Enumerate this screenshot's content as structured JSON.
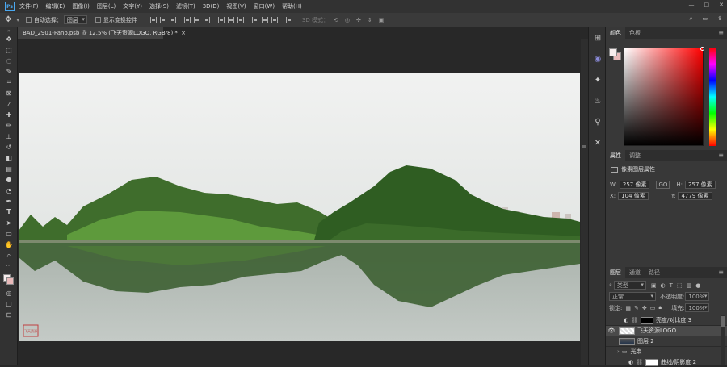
{
  "app": {
    "logo": "Ps"
  },
  "menu": [
    "文件(F)",
    "编辑(E)",
    "图像(I)",
    "图层(L)",
    "文字(Y)",
    "选择(S)",
    "滤镜(T)",
    "3D(D)",
    "视图(V)",
    "窗口(W)",
    "帮助(H)"
  ],
  "window_controls": [
    "—",
    "□",
    "✕"
  ],
  "options_bar": {
    "auto_select_label": "自动选择：",
    "auto_select_value": "图层",
    "show_transform_label": "显示变换控件",
    "mode_3d_label": "3D 模式："
  },
  "document": {
    "tab_title": "BAD_2901-Pano.psb @ 12.5% (飞天资源LOGO, RGB/8) *",
    "stamp_text": "飞天资源"
  },
  "color_panel": {
    "tabs": [
      "颜色",
      "色板"
    ],
    "fg_color": "#f6ecec",
    "bg_color": "#e9b9b9"
  },
  "properties_panel": {
    "tabs": [
      "属性",
      "调整"
    ],
    "title": "像素图层属性",
    "w_label": "W:",
    "w_value": "257 像素",
    "link_label": "GO",
    "h_label": "H:",
    "h_value": "257 像素",
    "x_label": "X:",
    "x_value": "104 像素",
    "y_label": "Y:",
    "y_value": "4779 像素"
  },
  "layers_panel": {
    "tabs": [
      "图层",
      "通道",
      "路径"
    ],
    "filter_value": "类型",
    "blend_mode": "正常",
    "opacity_label": "不透明度:",
    "opacity_value": "100%",
    "lock_label": "锁定:",
    "fill_label": "填充:",
    "fill_value": "100%",
    "layers": [
      {
        "name": "亮度/对比度 3",
        "visible": false,
        "selected": false
      },
      {
        "name": "飞天资源LOGO",
        "visible": true,
        "selected": true
      },
      {
        "name": "图层 2",
        "visible": false,
        "selected": false
      },
      {
        "name": "光束",
        "visible": false,
        "selected": false
      },
      {
        "name": "曲线/阴影度 2",
        "visible": false,
        "selected": false
      }
    ]
  }
}
